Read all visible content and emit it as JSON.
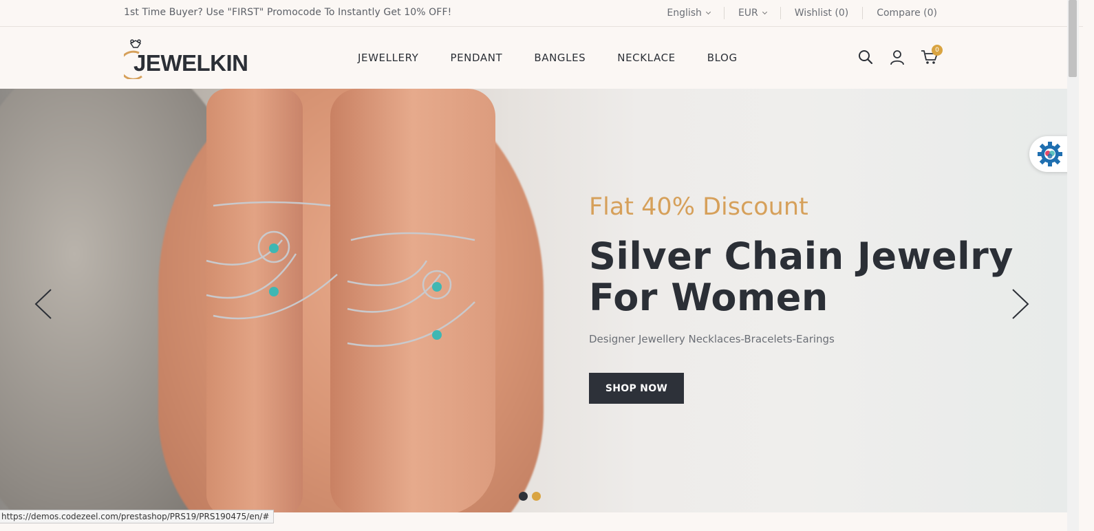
{
  "topbar": {
    "promo": "1st Time Buyer? Use \"FIRST\" Promocode To Instantly Get 10% OFF!",
    "language": "English",
    "currency": "EUR",
    "wishlist": "Wishlist (0)",
    "compare": "Compare (0)"
  },
  "header": {
    "logo": "JEWELKIN",
    "nav": [
      "JEWELLERY",
      "PENDANT",
      "BANGLES",
      "NECKLACE",
      "BLOG"
    ],
    "cart_count": "0",
    "icons": [
      "search-icon",
      "user-icon",
      "cart-icon"
    ]
  },
  "hero": {
    "pre_title": "Flat 40% Discount",
    "title": "Silver Chain Jewelry For Women",
    "subtitle": "Designer Jewellery Necklaces-Bracelets-Earings",
    "button": "SHOP NOW",
    "active_slide": 1,
    "slide_count": 2
  },
  "status_url": "https://demos.codezeel.com/prestashop/PRS19/PRS190475/en/#",
  "colors": {
    "accent": "#d6a05a",
    "dark": "#2d3139",
    "background": "#fbf7f4",
    "dot_active": "#d9a441",
    "dot_inactive": "#2d3139"
  }
}
